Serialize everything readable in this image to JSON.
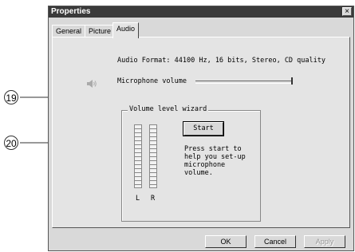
{
  "window": {
    "title": "Properties",
    "close_glyph": "×"
  },
  "tabs": [
    {
      "label": "General",
      "active": false
    },
    {
      "label": "Picture",
      "active": false
    },
    {
      "label": "Audio",
      "active": true
    }
  ],
  "audio": {
    "format_text": "Audio Format: 44100 Hz, 16 bits, Stereo, CD quality",
    "mic_label": "Microphone volume",
    "mic_icon": "speaker-icon"
  },
  "wizard": {
    "legend": "Volume level wizard",
    "start_label": "Start",
    "help_lines": [
      "Press start to",
      "help you set-up",
      "microphone",
      "volume."
    ],
    "left_label": "L",
    "right_label": "R"
  },
  "buttons": {
    "ok": "OK",
    "cancel": "Cancel",
    "apply": "Apply"
  },
  "callouts": {
    "c19": "19",
    "c20": "20"
  }
}
